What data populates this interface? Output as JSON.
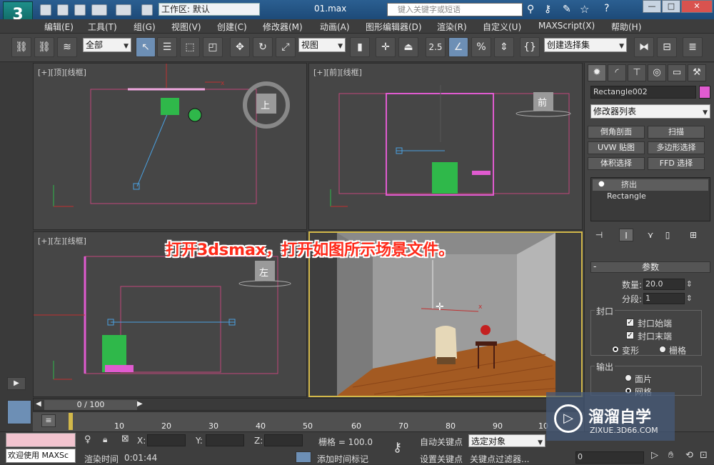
{
  "titlebar": {
    "logo": "3",
    "workspace": "工作区: 默认",
    "document": "01.max",
    "search_placeholder": "键入关键字或短语"
  },
  "menu": [
    "编辑(E)",
    "工具(T)",
    "组(G)",
    "视图(V)",
    "创建(C)",
    "修改器(M)",
    "动画(A)",
    "图形编辑器(D)",
    "渲染(R)",
    "自定义(U)",
    "MAXScript(X)",
    "帮助(H)"
  ],
  "toolbar": {
    "filter": "全部",
    "refcoord": "视图",
    "snap_value": "2.5",
    "selection_set": "创建选择集"
  },
  "viewports": {
    "top": "[+][顶][线框]",
    "front": "[+][前][线框]",
    "left": "[+][左][线框]",
    "viewcube_top": "上",
    "viewcube_front": "前",
    "viewcube_left": "左"
  },
  "caption": "打开3dsmax，打开如图所示场景文件。",
  "command_panel": {
    "object_name": "Rectangle002",
    "object_color": "#e05bd0",
    "modifier_list": "修改器列表",
    "modifier_buttons": [
      "倒角剖面",
      "扫描",
      "UVW 贴图",
      "多边形选择",
      "体积选择",
      "FFD 选择"
    ],
    "stack": [
      "挤出",
      "Rectangle"
    ],
    "rollout": "参数",
    "amount_label": "数量:",
    "amount_value": "20.0",
    "segments_label": "分段:",
    "segments_value": "1",
    "capping_group": "封口",
    "cap_start": "封口始端",
    "cap_end": "封口末端",
    "morph": "变形",
    "grid": "栅格",
    "output_group": "输出",
    "patch": "面片",
    "mesh": "网格"
  },
  "timeline": {
    "frame_counter": "0 / 100",
    "ticks": [
      "10",
      "20",
      "30",
      "40",
      "50",
      "60",
      "70",
      "80",
      "90",
      "10"
    ]
  },
  "status": {
    "welcome": "欢迎使用 MAXSc",
    "render_time_label": "渲染时间",
    "render_time": "0:01:44",
    "x_label": "X:",
    "y_label": "Y:",
    "z_label": "Z:",
    "grid_label": "栅格 = 100.0",
    "add_time_tag": "添加时间标记",
    "auto_key": "自动关键点",
    "set_key": "设置关键点",
    "selected_object": "选定对象",
    "key_filter": "关键点过滤器...",
    "frame_field": "0"
  },
  "watermark": {
    "title": "溜溜自学",
    "url": "ZIXUE.3D66.COM"
  }
}
